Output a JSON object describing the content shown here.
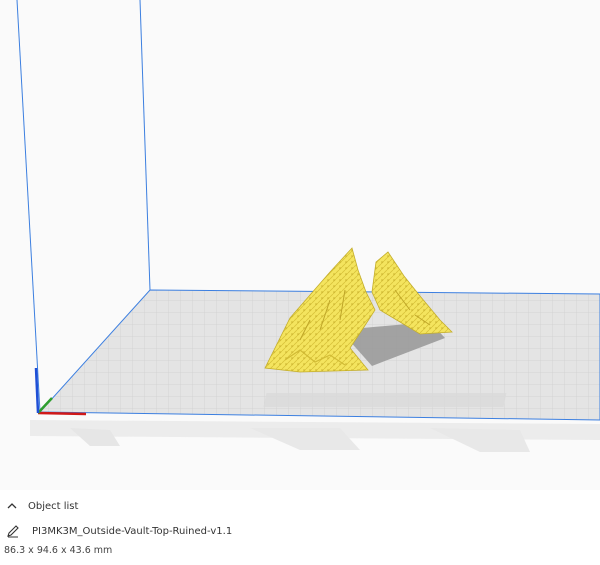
{
  "object_list": {
    "header_label": "Object list",
    "collapse_icon": "chevron-up-icon",
    "edit_icon": "pencil-icon",
    "object_name": "PI3MK3M_Outside-Vault-Top-Ruined-v1.1",
    "dimensions": "86.3 x 94.6 x 43.6 mm"
  },
  "viewport": {
    "bed_color": "#e4e4e4",
    "grid_color": "#c8c8c8",
    "model_color": "#f2e25a",
    "model_shadow_color": "#9a9a9a",
    "axis_x_color": "#d01818",
    "axis_y_color": "#2f9e2f",
    "axis_z_color": "#1f4fd6",
    "build_volume_edge_color": "#3c7fe0"
  }
}
